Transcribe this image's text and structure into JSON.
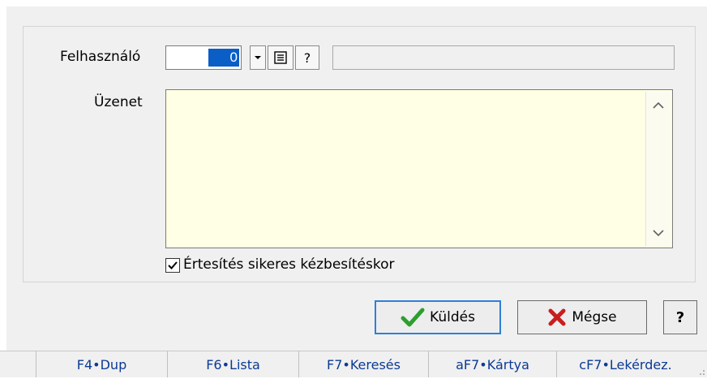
{
  "form": {
    "user_label": "Felhasználó",
    "user_value": "0",
    "user_name": "",
    "message_label": "Üzenet",
    "message_value": "",
    "notify_label": "Értesítés sikeres kézbesítéskor",
    "notify_checked": true
  },
  "icons": {
    "dropdown": "chevron-down-icon",
    "list": "list-icon",
    "help": "question-icon",
    "scroll_up": "chevron-up-icon",
    "scroll_down": "chevron-down-icon",
    "send": "checkmark-icon",
    "cancel": "x-icon"
  },
  "buttons": {
    "help_small": "?",
    "send": "Küldés",
    "cancel": "Mégse",
    "help": "?"
  },
  "statusbar": {
    "keys": [
      "F4•Dup",
      "F6•Lista",
      "F7•Keresés",
      "aF7•Kártya",
      "cF7•Lekérdez."
    ]
  },
  "colors": {
    "selection": "#0a5ec6",
    "message_bg": "#ffffe6",
    "send_check": "#2e9e2e",
    "cancel_x": "#c81e1e",
    "fkey_text": "#0b3a94"
  }
}
